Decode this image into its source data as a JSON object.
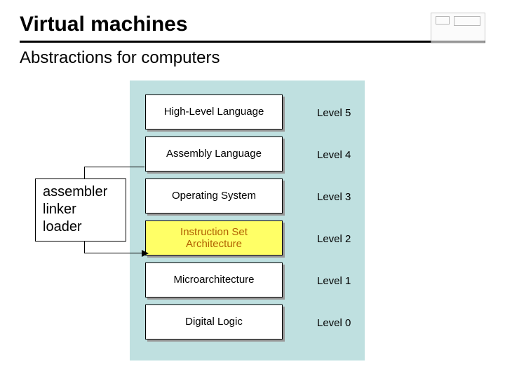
{
  "title": "Virtual machines",
  "subtitle": "Abstractions for computers",
  "layers": [
    {
      "name": "High-Level Language",
      "level": "Level 5",
      "highlight": false
    },
    {
      "name": "Assembly Language",
      "level": "Level 4",
      "highlight": false
    },
    {
      "name": "Operating System",
      "level": "Level 3",
      "highlight": false
    },
    {
      "name": "Instruction Set\nArchitecture",
      "level": "Level 2",
      "highlight": true
    },
    {
      "name": "Microarchitecture",
      "level": "Level 1",
      "highlight": false
    },
    {
      "name": "Digital Logic",
      "level": "Level 0",
      "highlight": false
    }
  ],
  "callout": {
    "line1": "assembler",
    "line2": "linker",
    "line3": "loader"
  }
}
